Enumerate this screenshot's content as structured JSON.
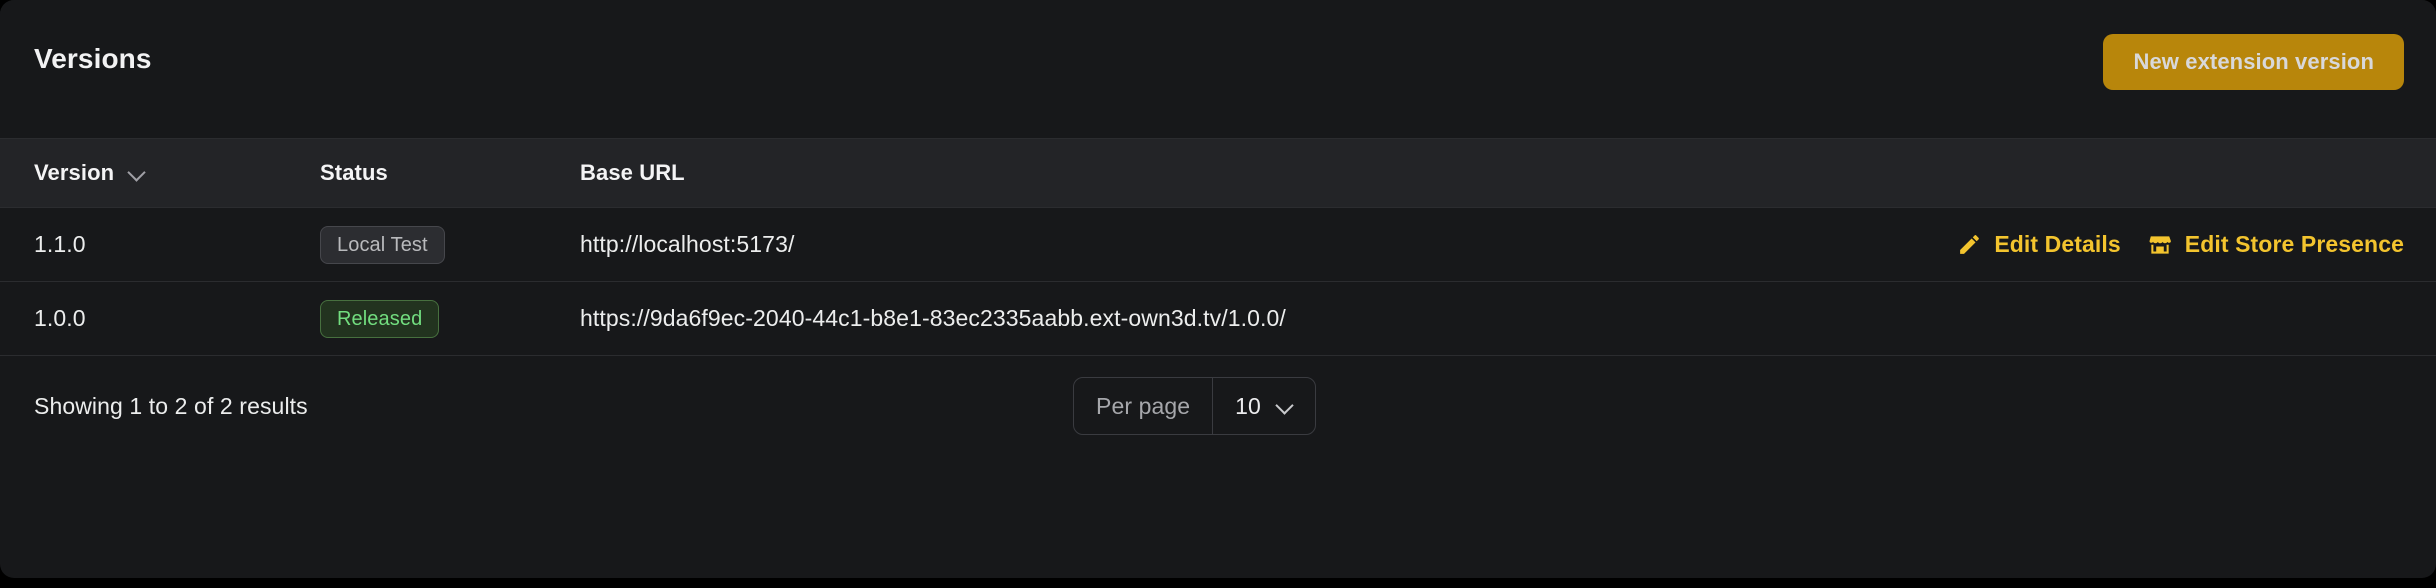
{
  "card": {
    "title": "Versions",
    "new_version_button": "New extension version"
  },
  "table": {
    "columns": {
      "version": "Version",
      "status": "Status",
      "base_url": "Base URL"
    },
    "sort_icon": "chevron-down-icon",
    "rows": [
      {
        "version": "1.1.0",
        "status": "Local Test",
        "status_variant": "neutral",
        "base_url": "http://localhost:5173/",
        "actions": [
          {
            "label": "Edit Details",
            "icon": "pencil-icon"
          },
          {
            "label": "Edit Store Presence",
            "icon": "storefront-icon"
          }
        ]
      },
      {
        "version": "1.0.0",
        "status": "Released",
        "status_variant": "success",
        "base_url": "https://9da6f9ec-2040-44c1-b8e1-83ec2335aabb.ext-own3d.tv/1.0.0/",
        "actions": []
      }
    ]
  },
  "footer": {
    "results_text": "Showing 1 to 2 of 2 results",
    "per_page_label": "Per page",
    "per_page_value": "10",
    "per_page_options": [
      "10"
    ]
  },
  "colors": {
    "page_background": "#000000",
    "card_background": "#17181a",
    "header_row_background": "#232427",
    "accent_button": "#b8860b",
    "accent_link": "#f3c42e",
    "badge_success_text": "#72dd7f",
    "badge_neutral_text": "#b9babd",
    "divider": "#2b2c2f"
  }
}
